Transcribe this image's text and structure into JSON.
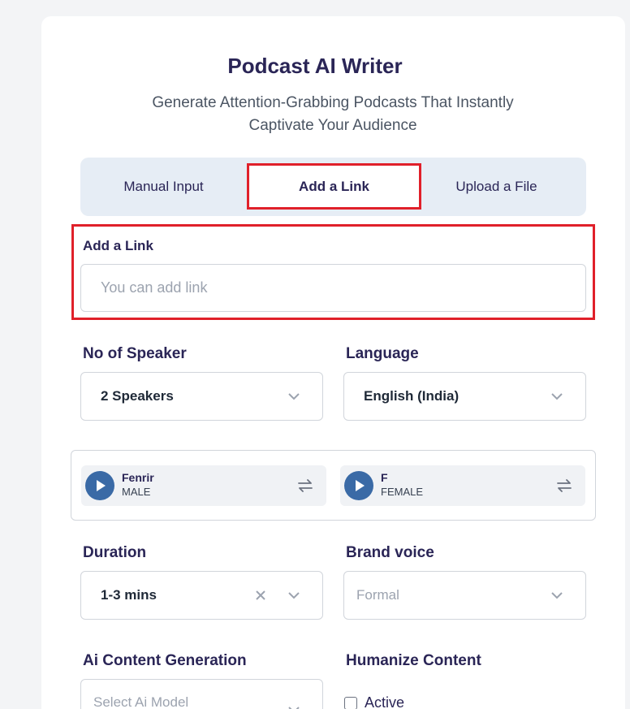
{
  "header": {
    "title": "Podcast AI Writer",
    "subtitle": "Generate Attention-Grabbing Podcasts That Instantly Captivate Your Audience"
  },
  "tabs": [
    {
      "label": "Manual Input",
      "active": false
    },
    {
      "label": "Add a Link",
      "active": true
    },
    {
      "label": "Upload a File",
      "active": false
    }
  ],
  "link": {
    "label": "Add a Link",
    "placeholder": "You can add link",
    "value": ""
  },
  "speakers": {
    "label": "No of Speaker",
    "value": "2 Speakers"
  },
  "language": {
    "label": "Language",
    "value": "English (India)"
  },
  "voices": [
    {
      "name": "Fenrir",
      "gender": "MALE"
    },
    {
      "name": "F",
      "gender": "FEMALE"
    }
  ],
  "duration": {
    "label": "Duration",
    "value": "1-3 mins"
  },
  "brand_voice": {
    "label": "Brand voice",
    "placeholder": "Formal"
  },
  "ai_content": {
    "label": "Ai Content Generation",
    "placeholder": "Select Ai Model"
  },
  "humanize": {
    "label": "Humanize Content",
    "checkbox_label": "Active",
    "checked": false
  },
  "colors": {
    "accent": "#3a6aa6",
    "highlight": "#e0202a",
    "title": "#2a2556"
  },
  "icons": {
    "chevron": "chevron-down-icon",
    "clear": "close-icon",
    "play": "play-icon",
    "swap": "swap-icon"
  }
}
